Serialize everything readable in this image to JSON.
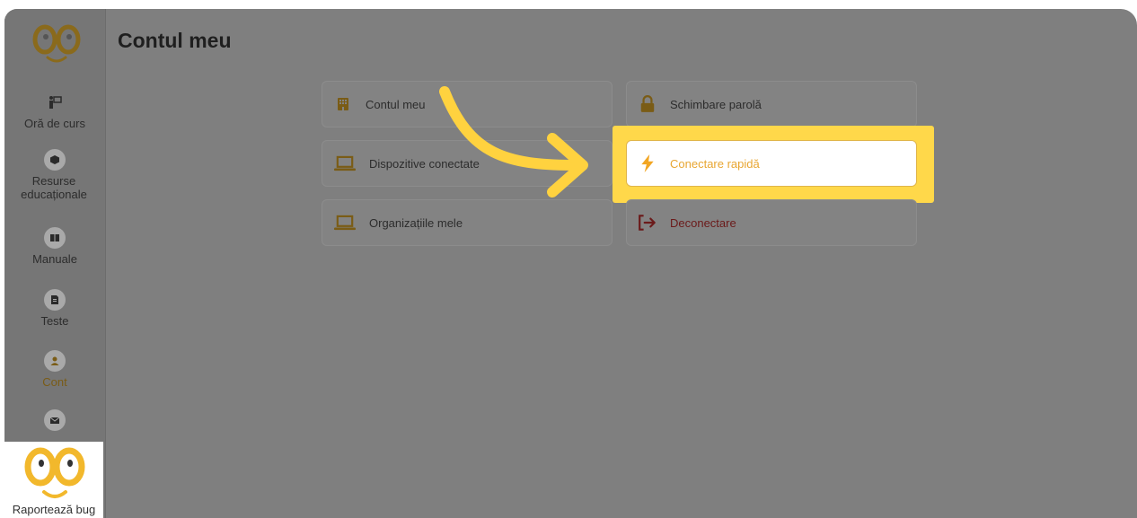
{
  "header": {
    "title": "Contul meu"
  },
  "sidebar": {
    "items": [
      {
        "label": "Oră de curs",
        "icon": "teacher-board-icon"
      },
      {
        "label": "Resurse educaționale",
        "icon": "cube-icon"
      },
      {
        "label": "Manuale",
        "icon": "book-icon"
      },
      {
        "label": "Teste",
        "icon": "document-icon"
      },
      {
        "label": "Cont",
        "icon": "user-icon",
        "active": true
      },
      {
        "label": "",
        "icon": "envelope-icon"
      }
    ],
    "bug_report": "Raportează bug"
  },
  "cards": [
    {
      "label": "Contul meu",
      "icon": "building-icon"
    },
    {
      "label": "Schimbare parolă",
      "icon": "lock-icon"
    },
    {
      "label": "Dispozitive conectate",
      "icon": "laptop-icon"
    },
    {
      "label": "Conectare rapidă",
      "icon": "lightning-icon",
      "highlighted": true
    },
    {
      "label": "Organizațiile mele",
      "icon": "laptop-icon"
    },
    {
      "label": "Deconectare",
      "icon": "sign-out-icon"
    }
  ],
  "colors": {
    "accent": "#e8a632",
    "highlight": "#ffd84a",
    "overlay": "#7f7f7f",
    "danger": "#6b1a1a"
  }
}
